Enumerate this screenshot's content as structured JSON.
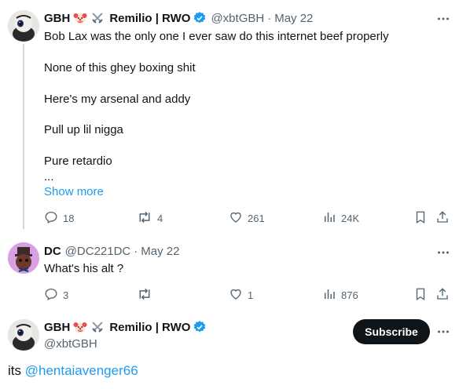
{
  "tweet1": {
    "display_name": "GBH",
    "community": "Remilio | RWO",
    "handle": "@xbtGBH",
    "separator": "·",
    "date": "May 22",
    "lines": [
      "Bob Lax was the only one I ever saw do this internet beef properly",
      "None of this ghey boxing shit",
      "Here's my arsenal and addy",
      "Pull up lil nigga",
      "Pure retardio",
      "..."
    ],
    "show_more": "Show more",
    "replies": "18",
    "reposts": "4",
    "likes": "261",
    "views": "24K"
  },
  "tweet2": {
    "display_name": "DC",
    "handle": "@DC221DC",
    "separator": "·",
    "date": "May 22",
    "text": "What's his alt ?",
    "replies": "3",
    "reposts": "",
    "likes": "1",
    "views": "876"
  },
  "reply": {
    "display_name": "GBH",
    "community": "Remilio | RWO",
    "handle": "@xbtGBH",
    "subscribe_label": "Subscribe",
    "text_prefix": "its ",
    "mention": "@hentaiavenger66"
  },
  "colors": {
    "accent": "#1d9bf0",
    "muted": "#536471",
    "text": "#0f1419"
  },
  "icons": [
    "clown-emoji",
    "crossed-swords-emoji",
    "verified-badge-icon",
    "more-icon",
    "reply-icon",
    "repost-icon",
    "like-icon",
    "views-icon",
    "bookmark-icon",
    "share-icon"
  ]
}
